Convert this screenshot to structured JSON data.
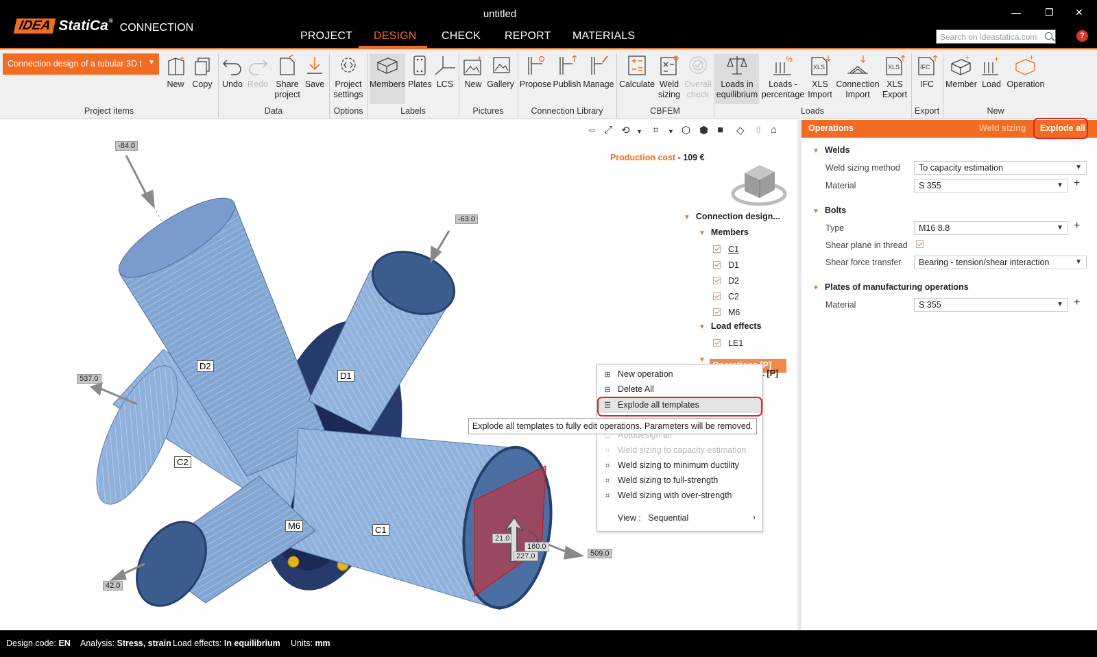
{
  "app": {
    "title": "untitled",
    "logo_brand": "IDEA",
    "logo_product": "StatiCa",
    "logo_module": "CONNECTION"
  },
  "menu": {
    "tabs": [
      "PROJECT",
      "DESIGN",
      "CHECK",
      "REPORT",
      "MATERIALS"
    ],
    "active_tab": "DESIGN",
    "search_placeholder": "Search on ideastatica.com"
  },
  "ribbon": {
    "project_dropdown": "Connection design of a tubular 3D t",
    "groups": {
      "project_items": "Project items",
      "data": "Data",
      "options": "Options",
      "labels": "Labels",
      "pictures": "Pictures",
      "connection_library": "Connection Library",
      "cbfem": "CBFEM",
      "loads": "Loads",
      "export": "Export",
      "new": "New"
    },
    "buttons": {
      "new": "New",
      "copy": "Copy",
      "undo": "Undo",
      "redo": "Redo",
      "share_project": [
        "Share",
        "project"
      ],
      "save": "Save",
      "project_settings": [
        "Project",
        "settings"
      ],
      "members": "Members",
      "plates": "Plates",
      "lcs": "LCS",
      "new_picture": "New",
      "gallery": "Gallery",
      "propose": "Propose",
      "publish": "Publish",
      "manage": "Manage",
      "calculate": "Calculate",
      "weld_sizing": [
        "Weld",
        "sizing"
      ],
      "overall_check": [
        "Overall",
        "check"
      ],
      "loads_equilibrium": [
        "Loads in",
        "equilibrium"
      ],
      "loads_percentage": [
        "Loads -",
        "percentage"
      ],
      "xls_import": [
        "XLS",
        "Import"
      ],
      "connection_import": [
        "Connection",
        "Import"
      ],
      "xls_export": [
        "XLS",
        "Export"
      ],
      "ifc": "IFC",
      "member": "Member",
      "load": "Load",
      "operation": "Operation"
    }
  },
  "viewport": {
    "production_cost_label": "Production cost",
    "production_cost_value": "109 €",
    "dimension_labels": [
      "-84.0",
      "-63.0",
      "537.0",
      "42.0",
      "509.0",
      "21.0",
      "160.0",
      "227.0"
    ],
    "member_labels": [
      "D2",
      "D1",
      "C2",
      "M6",
      "C1"
    ]
  },
  "tree": {
    "root": "Connection design...",
    "members_label": "Members",
    "members": [
      "C1",
      "D1",
      "D2",
      "C2",
      "M6"
    ],
    "load_effects_label": "Load effects",
    "load_effects": [
      "LE1"
    ],
    "operations_label": "Operations [P]",
    "operation_child_suffix": "1 [P]"
  },
  "context_menu": {
    "items": [
      {
        "label": "New operation",
        "icon": "new-operation-icon",
        "enabled": true
      },
      {
        "label": "Delete All",
        "icon": "delete-all-icon",
        "enabled": true
      },
      {
        "label": "Explode all templates",
        "icon": "explode-icon",
        "enabled": true,
        "highlighted": true
      },
      {
        "label": "Autodesign all",
        "icon": "autodesign-icon",
        "enabled": false
      },
      {
        "label": "Weld sizing to capacity estimation",
        "icon": "weld-icon",
        "enabled": false
      },
      {
        "label": "Weld sizing to minimum ductility",
        "icon": "weld-icon",
        "enabled": true
      },
      {
        "label": "Weld sizing to full-strength",
        "icon": "weld-icon",
        "enabled": true
      },
      {
        "label": "Weld sizing with over-strength",
        "icon": "weld-icon",
        "enabled": true
      }
    ],
    "view_label": "View :",
    "view_value": "Sequential",
    "tooltip": "Explode all templates to fully edit operations. Parameters will be removed."
  },
  "right_panel": {
    "title": "Operations",
    "weld_sizing_tab": "Weld sizing",
    "explode_all": "Explode all",
    "sections": {
      "welds": {
        "title": "Welds",
        "weld_sizing_method_label": "Weld sizing method",
        "weld_sizing_method_value": "To capacity estimation",
        "material_label": "Material",
        "material_value": "S 355"
      },
      "bolts": {
        "title": "Bolts",
        "type_label": "Type",
        "type_value": "M16 8.8",
        "shear_plane_label": "Shear plane in thread",
        "shear_plane_checked": true,
        "shear_force_label": "Shear force transfer",
        "shear_force_value": "Bearing - tension/shear interaction"
      },
      "plates": {
        "title": "Plates of manufacturing operations",
        "material_label": "Material",
        "material_value": "S 355"
      }
    }
  },
  "status_bar": {
    "design_code_label": "Design code:",
    "design_code_value": "EN",
    "analysis_label": "Analysis:",
    "analysis_value": "Stress, strain",
    "load_effects_label": "Load effects:",
    "load_effects_value": "In equilibrium",
    "units_label": "Units:",
    "units_value": "mm"
  },
  "colors": {
    "accent": "#f26b22",
    "highlight_ring": "#e02424",
    "tube": "#8fb1dc",
    "tube_dark": "#4f6d99",
    "bolt": "#e1b21a"
  }
}
